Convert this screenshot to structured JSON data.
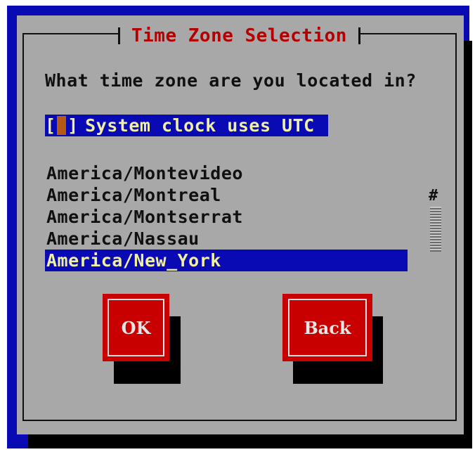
{
  "dialog": {
    "title": "Time Zone Selection",
    "question": "What time zone are you located in?"
  },
  "utc_checkbox": {
    "open_bracket": "[",
    "close_bracket": "]",
    "label": "System clock uses UTC",
    "checked": false
  },
  "timezones": {
    "items": [
      "America/Montevideo",
      "America/Montreal",
      "America/Montserrat",
      "America/Nassau",
      "America/New_York"
    ],
    "selected": "America/New_York",
    "scroll_marker": "#"
  },
  "buttons": {
    "ok_label": "OK",
    "back_label": "Back"
  },
  "colors": {
    "screen_bg": "#0a0ab4",
    "dialog_bg": "#a8a8a8",
    "title_text": "#b40000",
    "highlight_bg": "#0a0ab4",
    "highlight_text": "#f0f0a0",
    "button_bg": "#c80000"
  }
}
